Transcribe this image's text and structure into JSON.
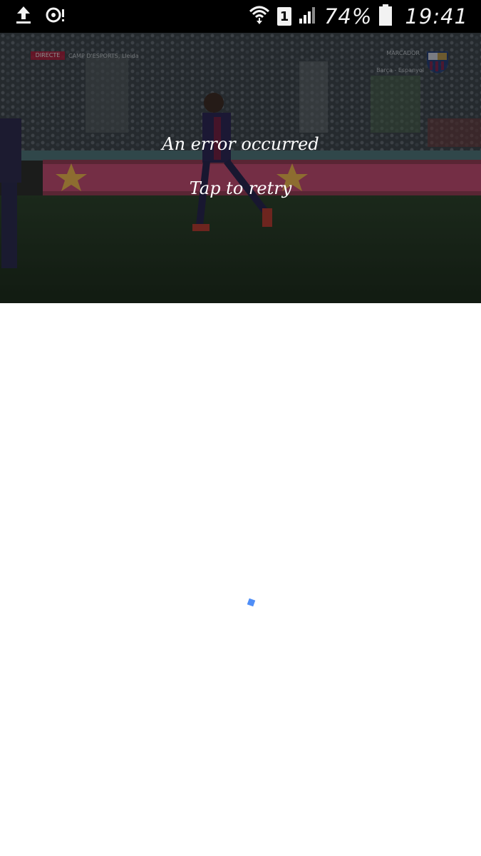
{
  "status_bar": {
    "icons_left": [
      "upload-icon",
      "sync-alert-icon"
    ],
    "icons_right": [
      "wifi-icon",
      "sim-1-icon",
      "signal-icon",
      "battery-icon"
    ],
    "sim_label": "1",
    "battery": "74%",
    "time": "19:41"
  },
  "video": {
    "live_badge": "DIRECTE",
    "location": "CAMP D'ESPORTS, Lleida",
    "score_label": "MARCADOR",
    "score_line": "Barça - Espanyol",
    "error_message": "An error occurred",
    "retry_label": "Tap to retry",
    "colors": {
      "overlay_text": "#ffffff",
      "pitch": "#1f3320",
      "ad_board": "#c0385a"
    }
  },
  "loading": {
    "indicator": "loading-spinner",
    "color": "#4f8ef7"
  }
}
